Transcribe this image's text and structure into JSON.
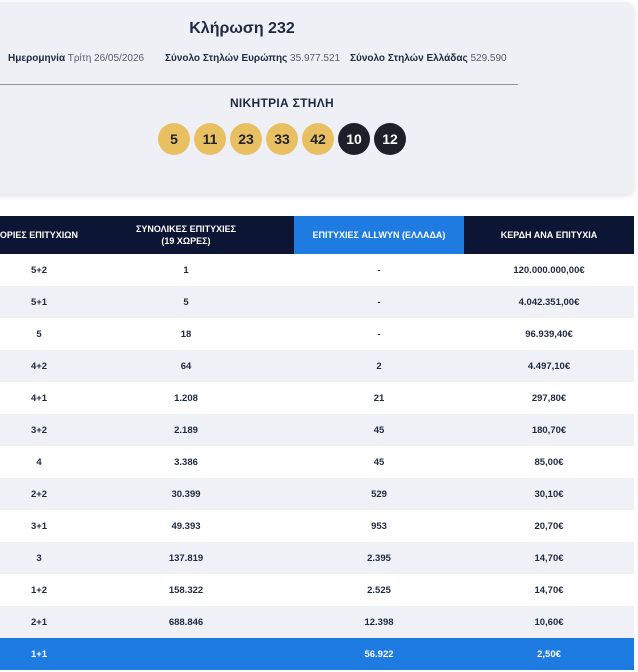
{
  "draw": {
    "title": "Κλήρωση 232",
    "date_label": "Ημερομηνία",
    "date_value": "Τρίτη 26/05/2026",
    "europe_label": "Σύνολο Στηλών Ευρώπης",
    "europe_value": "35.977.521",
    "greece_label": "Σύνολο Στηλών Ελλάδας",
    "greece_value": "529.590"
  },
  "winning": {
    "label": "ΝΙΚΗΤΡΙΑ ΣΤΗΛΗ",
    "numbers": [
      "5",
      "11",
      "23",
      "33",
      "42"
    ],
    "stars": [
      "10",
      "12"
    ]
  },
  "table": {
    "headers": {
      "category": "ΗΓΟΡΙΕΣ ΕΠΙΤΥΧΙΩΝ",
      "total_line1": "ΣΥΝΟΛΙΚΕΣ ΕΠΙΤΥΧΙΕΣ",
      "total_line2": "(19 ΧΩΡΕΣ)",
      "allwyn": "ΕΠΙΤΥΧΙΕΣ ALLWYN (ΕΛΛΑΔΑ)",
      "prize": "ΚΕΡΔΗ ΑΝΑ ΕΠΙΤΥΧΙΑ"
    },
    "rows": [
      {
        "cat": "5+2",
        "total": "1",
        "allwyn": "-",
        "prize": "120.000.000,00€"
      },
      {
        "cat": "5+1",
        "total": "5",
        "allwyn": "-",
        "prize": "4.042.351,00€"
      },
      {
        "cat": "5",
        "total": "18",
        "allwyn": "-",
        "prize": "96.939,40€"
      },
      {
        "cat": "4+2",
        "total": "64",
        "allwyn": "2",
        "prize": "4.497,10€"
      },
      {
        "cat": "4+1",
        "total": "1.208",
        "allwyn": "21",
        "prize": "297,80€"
      },
      {
        "cat": "3+2",
        "total": "2.189",
        "allwyn": "45",
        "prize": "180,70€"
      },
      {
        "cat": "4",
        "total": "3.386",
        "allwyn": "45",
        "prize": "85,00€"
      },
      {
        "cat": "2+2",
        "total": "30.399",
        "allwyn": "529",
        "prize": "30,10€"
      },
      {
        "cat": "3+1",
        "total": "49.393",
        "allwyn": "953",
        "prize": "20,70€"
      },
      {
        "cat": "3",
        "total": "137.819",
        "allwyn": "2.395",
        "prize": "14,70€"
      },
      {
        "cat": "1+2",
        "total": "158.322",
        "allwyn": "2.525",
        "prize": "14,70€"
      },
      {
        "cat": "2+1",
        "total": "688.846",
        "allwyn": "12.398",
        "prize": "10,60€"
      },
      {
        "cat": "1+1",
        "total": "",
        "allwyn": "56.922",
        "prize": "2,50€"
      }
    ]
  },
  "colors": {
    "header_bg": "#0c1634",
    "accent_blue": "#1e7be1",
    "ball_gold": "#e8c061",
    "ball_dark": "#1d2029"
  }
}
